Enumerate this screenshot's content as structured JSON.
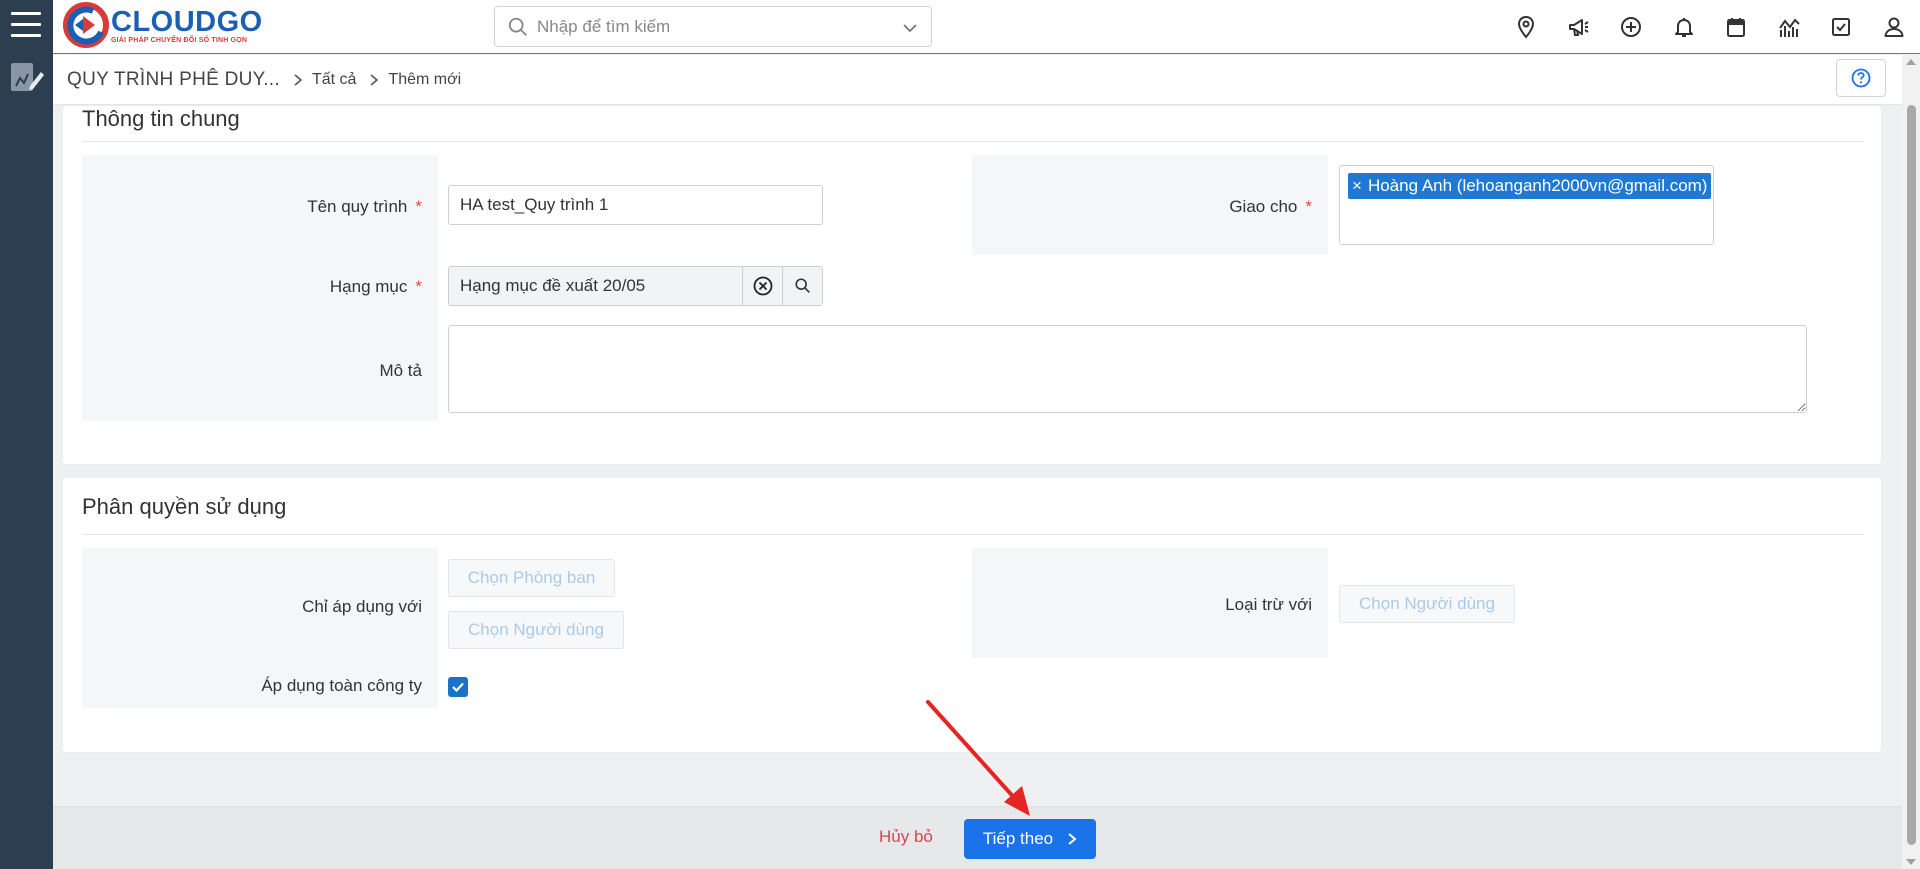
{
  "app": {
    "logo_name": "CLOUDGO",
    "logo_tagline": "GIẢI PHÁP CHUYỂN ĐỔI SỐ TINH GỌN"
  },
  "search": {
    "placeholder": "Nhập để tìm kiếm"
  },
  "top_icons": [
    "location-pin-icon",
    "megaphone-icon",
    "plus-circle-icon",
    "bell-icon",
    "calendar-icon",
    "chart-icon",
    "checkbox-task-icon",
    "user-icon"
  ],
  "breadcrumb": {
    "module": "QUY TRÌNH PHÊ DUY...",
    "level1": "Tất cả",
    "level2": "Thêm mới"
  },
  "general": {
    "title": "Thông tin chung",
    "name_label": "Tên quy trình",
    "name_value": "HA test_Quy trình 1",
    "assign_label": "Giao cho",
    "assign_tag": "Hoàng Anh (lehoanganh2000vn@gmail.com)",
    "category_label": "Hạng mục",
    "category_value": "Hạng mục đề xuất 20/05",
    "desc_label": "Mô tả",
    "desc_value": "",
    "required_mark": "*"
  },
  "permission": {
    "title": "Phân quyền sử dụng",
    "apply_label": "Chỉ áp dụng với",
    "choose_department": "Chọn Phòng ban",
    "choose_user": "Chọn Người dùng",
    "exclude_label": "Loại trừ với",
    "exclude_choose_user": "Chọn Người dùng",
    "company_label": "Áp dụng toàn công ty",
    "company_checked": true
  },
  "footer": {
    "cancel": "Hủy bỏ",
    "next": "Tiếp theo"
  },
  "colors": {
    "sidebar": "#2c3e50",
    "primary": "#1a73e8",
    "danger": "#d9454f",
    "header_rule": "#2e9c6a"
  }
}
